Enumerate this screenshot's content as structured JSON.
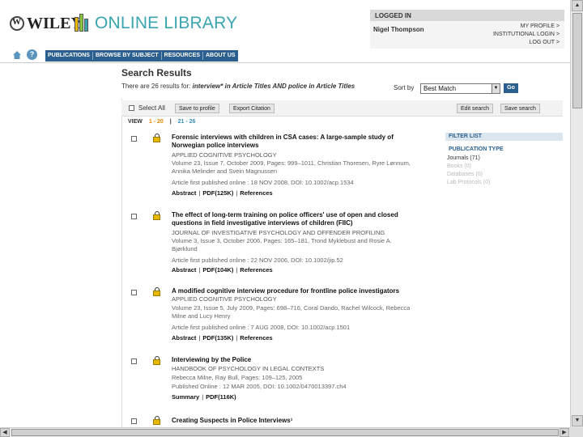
{
  "header": {
    "brand": "WILEY",
    "product": "ONLINE LIBRARY"
  },
  "login": {
    "title": "LOGGED IN",
    "user": "Nigel Thompson",
    "links": [
      "MY PROFILE >",
      "INSTITUTIONAL LOGIN >",
      "LOG OUT >"
    ]
  },
  "nav": {
    "items": [
      "PUBLICATIONS",
      "BROWSE BY SUBJECT",
      "RESOURCES",
      "ABOUT US"
    ]
  },
  "search": {
    "title": "Search Results",
    "summary_prefix": "There are 26 results for: ",
    "summary_query": "interview* in Article Titles AND police in Article Titles",
    "sort_label": "Sort by",
    "sort_value": "Best Match",
    "go_label": "Go"
  },
  "toolbar": {
    "select_all": "Select All",
    "save_profile": "Save to profile",
    "export_citation": "Export Citation",
    "edit_search": "Edit search",
    "save_search": "Save search"
  },
  "view": {
    "label": "VIEW",
    "pages": [
      "1 - 20",
      "21 - 26"
    ]
  },
  "results": [
    {
      "title": "Forensic interviews with children in CSA cases: A large-sample study of Norwegian police interviews",
      "journal": "APPLIED COGNITIVE PSYCHOLOGY",
      "meta1": "Volume 23, Issue 7, October 2009, Pages: 999–1011, Christian Thoresen, Ryre Lønnum, Annika Melinder and Svein Magnussen",
      "meta2": "Article first published online : 18 NOV 2008, DOI: 10.1002/acp.1534",
      "links": [
        "Abstract",
        "PDF(125K)",
        "References"
      ]
    },
    {
      "title": "The effect of long-term training on police officers' use of open and closed questions in field investigative interviews of children (FIIC)",
      "journal": "JOURNAL OF INVESTIGATIVE PSYCHOLOGY AND OFFENDER PROFILING",
      "meta1": "Volume 3, Issue 3, October 2006, Pages: 165–181, Trond Myklebust and Rosie A. Bjørklund",
      "meta2": "Article first published online : 22 NOV 2006, DOI: 10.1002/jip.52",
      "links": [
        "Abstract",
        "PDF(104K)",
        "References"
      ]
    },
    {
      "title": "A modified cognitive interview procedure for frontline police investigators",
      "journal": "APPLIED COGNITIVE PSYCHOLOGY",
      "meta1": "Volume 23, Issue 5, July 2009, Pages: 698–716, Coral Dando, Rachel Wilcock, Rebecca Milne and Lucy Henry",
      "meta2": "Article first published online : 7 AUG 2008, DOI: 10.1002/acp.1501",
      "links": [
        "Abstract",
        "PDF(135K)",
        "References"
      ]
    },
    {
      "title": "Interviewing by the Police",
      "journal": "HANDBOOK OF PSYCHOLOGY IN LEGAL CONTEXTS",
      "meta1": "Rebecca Milne, Ray Bull, Pages: 109–125, 2005",
      "meta2": "Published Online : 12 MAR 2005, DOI: 10.1002/0470013397.ch4",
      "links": [
        "Summary",
        "PDF(116K)"
      ]
    },
    {
      "title": "Creating Suspects in Police Interviews¹",
      "journal": "",
      "meta1": "",
      "meta2": "",
      "links": []
    }
  ],
  "filter": {
    "title": "FILTER LIST",
    "heading": "PUBLICATION TYPE",
    "options": [
      "Journals (71)",
      "Books (0)",
      "Databases (0)",
      "Lab Protocols (0)"
    ]
  },
  "colors": {
    "nav_bg": "#2b5f8e",
    "logo_accent": "#3aa5b0",
    "lock": "#e8b800",
    "page_current": "#e08a00",
    "page_link": "#3a8fc0"
  }
}
